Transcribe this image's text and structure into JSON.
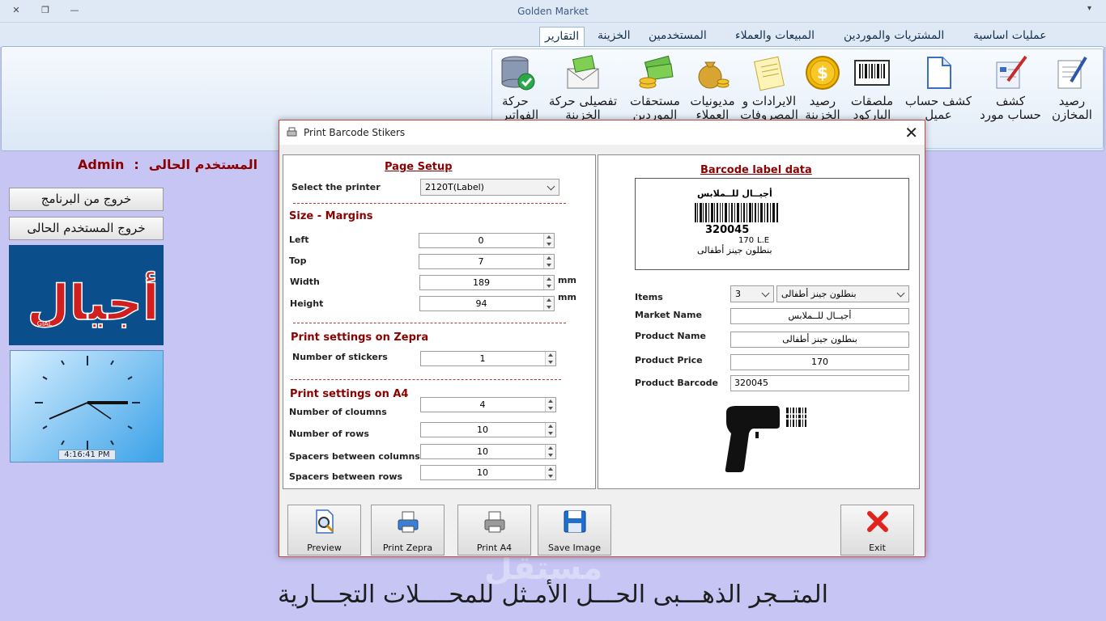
{
  "window": {
    "title": "Golden Market"
  },
  "ribbon": {
    "tabs": [
      "عمليات اساسية",
      "المشتريات والموردين",
      "المبيعات والعملاء",
      "المستخدمين",
      "الخزينة",
      "التقارير"
    ],
    "active_tab": "التقارير",
    "buttons": [
      {
        "label": "رصيد المخازن",
        "icon": "document-pen-icon"
      },
      {
        "label": "كشف حساب مورد",
        "icon": "form-pen-icon"
      },
      {
        "label": "كشف حساب عميل",
        "icon": "page-icon"
      },
      {
        "label": "ملصقات الباركود",
        "icon": "barcode-icon"
      },
      {
        "label": "رصيد الخزينة",
        "icon": "gold-coin-icon"
      },
      {
        "label": "الايرادات و المصروفات",
        "icon": "notepad-icon"
      },
      {
        "label": "مديونيات العملاء",
        "icon": "money-bag-icon"
      },
      {
        "label": "مستحقات الموردين",
        "icon": "cash-coins-icon"
      },
      {
        "label": "تفصيلى حركة الخزينة",
        "icon": "money-envelope-icon"
      },
      {
        "label": "حركة الفواتير",
        "icon": "database-check-icon"
      }
    ]
  },
  "sidebar": {
    "current_user_label": "المستخدم الحالى",
    "separator": ":",
    "current_user": "Admin",
    "exit_program": "خروج من البرنامج",
    "logout_user": "خروج المستخدم الحالى",
    "logo_text": "أجيال",
    "logo_sub": "GIAL",
    "clock_time": "4:16:41 PM"
  },
  "footer": {
    "slogan": "المتــجر الذهـــبى الحـــل الأمـثل للمحــــلات التجـــارية",
    "watermark": "مستقل"
  },
  "dialog": {
    "title": "Print Barcode Stikers",
    "page_setup": {
      "heading": "Page Setup",
      "printer_label": "Select the printer",
      "printer_value": "2120T(Label)",
      "margins_heading": "Size - Margins",
      "left_label": "Left",
      "left_value": "0",
      "top_label": "Top",
      "top_value": "7",
      "width_label": "Width",
      "width_value": "189",
      "width_unit": "mm",
      "height_label": "Height",
      "height_value": "94",
      "height_unit": "mm",
      "zepra_heading": "Print settings on Zepra",
      "stickers_label": "Number of  stickers",
      "stickers_value": "1",
      "a4_heading": "Print settings on A4",
      "columns_label": "Number of cloumns",
      "columns_value": "4",
      "rows_label": "Number of rows",
      "rows_value": "10",
      "spacer_cols_label": "Spacers between columns",
      "spacer_cols_value": "10",
      "spacer_rows_label": "Spacers between rows",
      "spacer_rows_value": "10"
    },
    "label_data": {
      "heading": "Barcode label data",
      "preview": {
        "market": "أجيــال للــملابس",
        "code": "320045",
        "price": "170",
        "currency": "L.E",
        "product": "بنطلون جينز أطفالى"
      },
      "items_label": "Items",
      "items_qty": "3",
      "items_value": "بنطلون جينز أطفالى",
      "market_label": "Market Name",
      "market_value": "أجيــال للــملابس",
      "product_label": "Product Name",
      "product_value": "بنطلون جينز أطفالى",
      "price_label": "Product Price",
      "price_value": "170",
      "barcode_label": "Product Barcode",
      "barcode_value": "320045"
    },
    "buttons": {
      "preview": "Preview",
      "print_zepra": "Print Zepra",
      "print_a4": "Print A4",
      "save_image": "Save Image",
      "exit": "Exit"
    }
  }
}
